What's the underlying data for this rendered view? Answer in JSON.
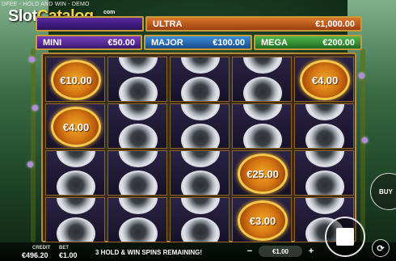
{
  "header": {
    "breadcrumb": "DFEE - HOLD AND WIN - DEMO",
    "logo_main": "Slot",
    "logo_accent": "Catalog",
    "logo_sup": "com"
  },
  "jackpots": {
    "ultra": {
      "label": "ULTRA",
      "value": "€1,000.00"
    },
    "mini": {
      "label": "MINI",
      "value": "€50.00"
    },
    "major": {
      "label": "MAJOR",
      "value": "€100.00"
    },
    "mega": {
      "label": "MEGA",
      "value": "€200.00"
    }
  },
  "grid": {
    "rows": [
      [
        "€10.00",
        "",
        "",
        "",
        "€4.00"
      ],
      [
        "€4.00",
        "",
        "",
        "",
        ""
      ],
      [
        "",
        "",
        "",
        "€25.00",
        ""
      ],
      [
        "",
        "",
        "",
        "€3.00",
        ""
      ]
    ]
  },
  "bottom_bar": {
    "credit_label": "CREDIT",
    "credit_value": "€496.20",
    "bet_label": "BET",
    "bet_value": "€1.00",
    "spins_message": "3 HOLD & WIN SPINS REMAINING!",
    "stake_value": "€1.00",
    "minus_symbol": "−",
    "plus_symbol": "+",
    "buy_label": "BUY",
    "auto_symbol": "⟳"
  },
  "colors": {
    "frame_gold": "#b8893a",
    "coin_orange": "#d77a14",
    "ultra": "#d9782a",
    "mini": "#7a3ec0",
    "major": "#3a8fd8",
    "mega": "#4fb84a"
  },
  "icons": {
    "spin_button": "stop-square-icon",
    "autoplay": "autoplay-icon"
  }
}
